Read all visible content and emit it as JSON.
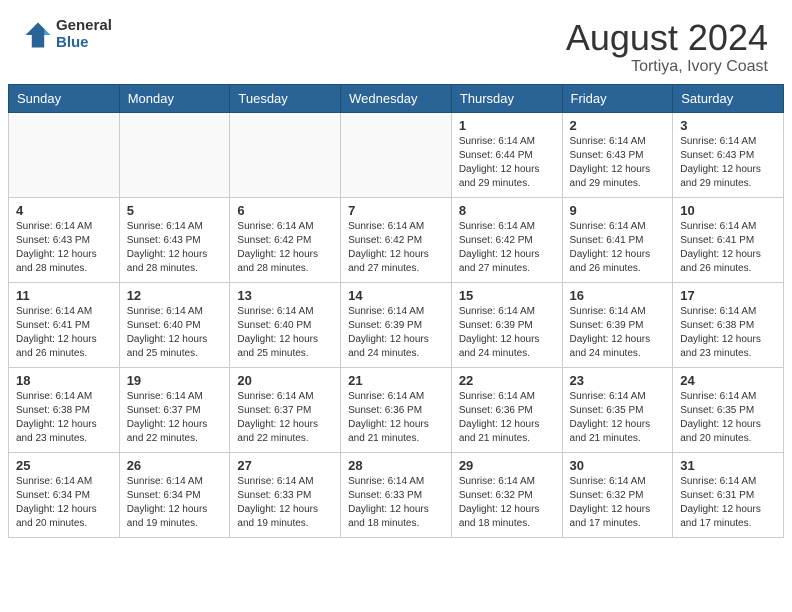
{
  "header": {
    "logo_general": "General",
    "logo_blue": "Blue",
    "month_year": "August 2024",
    "location": "Tortiya, Ivory Coast"
  },
  "weekdays": [
    "Sunday",
    "Monday",
    "Tuesday",
    "Wednesday",
    "Thursday",
    "Friday",
    "Saturday"
  ],
  "weeks": [
    [
      {
        "day": "",
        "info": ""
      },
      {
        "day": "",
        "info": ""
      },
      {
        "day": "",
        "info": ""
      },
      {
        "day": "",
        "info": ""
      },
      {
        "day": "1",
        "info": "Sunrise: 6:14 AM\nSunset: 6:44 PM\nDaylight: 12 hours\nand 29 minutes."
      },
      {
        "day": "2",
        "info": "Sunrise: 6:14 AM\nSunset: 6:43 PM\nDaylight: 12 hours\nand 29 minutes."
      },
      {
        "day": "3",
        "info": "Sunrise: 6:14 AM\nSunset: 6:43 PM\nDaylight: 12 hours\nand 29 minutes."
      }
    ],
    [
      {
        "day": "4",
        "info": "Sunrise: 6:14 AM\nSunset: 6:43 PM\nDaylight: 12 hours\nand 28 minutes."
      },
      {
        "day": "5",
        "info": "Sunrise: 6:14 AM\nSunset: 6:43 PM\nDaylight: 12 hours\nand 28 minutes."
      },
      {
        "day": "6",
        "info": "Sunrise: 6:14 AM\nSunset: 6:42 PM\nDaylight: 12 hours\nand 28 minutes."
      },
      {
        "day": "7",
        "info": "Sunrise: 6:14 AM\nSunset: 6:42 PM\nDaylight: 12 hours\nand 27 minutes."
      },
      {
        "day": "8",
        "info": "Sunrise: 6:14 AM\nSunset: 6:42 PM\nDaylight: 12 hours\nand 27 minutes."
      },
      {
        "day": "9",
        "info": "Sunrise: 6:14 AM\nSunset: 6:41 PM\nDaylight: 12 hours\nand 26 minutes."
      },
      {
        "day": "10",
        "info": "Sunrise: 6:14 AM\nSunset: 6:41 PM\nDaylight: 12 hours\nand 26 minutes."
      }
    ],
    [
      {
        "day": "11",
        "info": "Sunrise: 6:14 AM\nSunset: 6:41 PM\nDaylight: 12 hours\nand 26 minutes."
      },
      {
        "day": "12",
        "info": "Sunrise: 6:14 AM\nSunset: 6:40 PM\nDaylight: 12 hours\nand 25 minutes."
      },
      {
        "day": "13",
        "info": "Sunrise: 6:14 AM\nSunset: 6:40 PM\nDaylight: 12 hours\nand 25 minutes."
      },
      {
        "day": "14",
        "info": "Sunrise: 6:14 AM\nSunset: 6:39 PM\nDaylight: 12 hours\nand 24 minutes."
      },
      {
        "day": "15",
        "info": "Sunrise: 6:14 AM\nSunset: 6:39 PM\nDaylight: 12 hours\nand 24 minutes."
      },
      {
        "day": "16",
        "info": "Sunrise: 6:14 AM\nSunset: 6:39 PM\nDaylight: 12 hours\nand 24 minutes."
      },
      {
        "day": "17",
        "info": "Sunrise: 6:14 AM\nSunset: 6:38 PM\nDaylight: 12 hours\nand 23 minutes."
      }
    ],
    [
      {
        "day": "18",
        "info": "Sunrise: 6:14 AM\nSunset: 6:38 PM\nDaylight: 12 hours\nand 23 minutes."
      },
      {
        "day": "19",
        "info": "Sunrise: 6:14 AM\nSunset: 6:37 PM\nDaylight: 12 hours\nand 22 minutes."
      },
      {
        "day": "20",
        "info": "Sunrise: 6:14 AM\nSunset: 6:37 PM\nDaylight: 12 hours\nand 22 minutes."
      },
      {
        "day": "21",
        "info": "Sunrise: 6:14 AM\nSunset: 6:36 PM\nDaylight: 12 hours\nand 21 minutes."
      },
      {
        "day": "22",
        "info": "Sunrise: 6:14 AM\nSunset: 6:36 PM\nDaylight: 12 hours\nand 21 minutes."
      },
      {
        "day": "23",
        "info": "Sunrise: 6:14 AM\nSunset: 6:35 PM\nDaylight: 12 hours\nand 21 minutes."
      },
      {
        "day": "24",
        "info": "Sunrise: 6:14 AM\nSunset: 6:35 PM\nDaylight: 12 hours\nand 20 minutes."
      }
    ],
    [
      {
        "day": "25",
        "info": "Sunrise: 6:14 AM\nSunset: 6:34 PM\nDaylight: 12 hours\nand 20 minutes."
      },
      {
        "day": "26",
        "info": "Sunrise: 6:14 AM\nSunset: 6:34 PM\nDaylight: 12 hours\nand 19 minutes."
      },
      {
        "day": "27",
        "info": "Sunrise: 6:14 AM\nSunset: 6:33 PM\nDaylight: 12 hours\nand 19 minutes."
      },
      {
        "day": "28",
        "info": "Sunrise: 6:14 AM\nSunset: 6:33 PM\nDaylight: 12 hours\nand 18 minutes."
      },
      {
        "day": "29",
        "info": "Sunrise: 6:14 AM\nSunset: 6:32 PM\nDaylight: 12 hours\nand 18 minutes."
      },
      {
        "day": "30",
        "info": "Sunrise: 6:14 AM\nSunset: 6:32 PM\nDaylight: 12 hours\nand 17 minutes."
      },
      {
        "day": "31",
        "info": "Sunrise: 6:14 AM\nSunset: 6:31 PM\nDaylight: 12 hours\nand 17 minutes."
      }
    ]
  ]
}
